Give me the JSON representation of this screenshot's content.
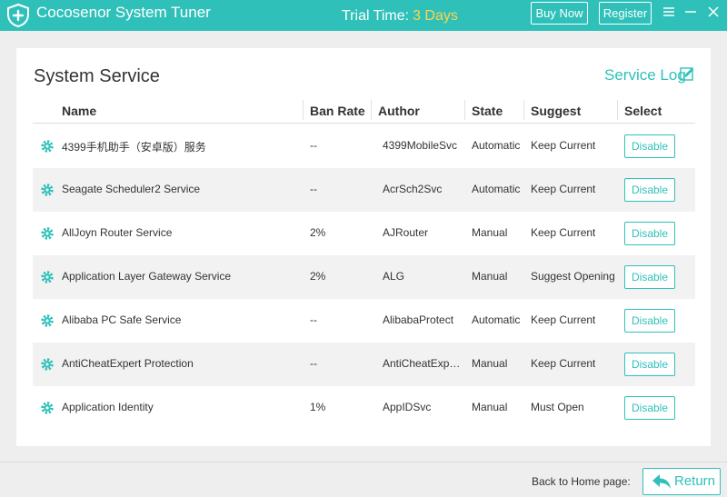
{
  "app": {
    "title": "Cocosenor System Tuner",
    "trial_label": "Trial Time:",
    "trial_days": "3 Days",
    "buy_label": "Buy Now",
    "register_label": "Register",
    "icons": {
      "logo": "shield-plus-icon",
      "menu": "menu-icon",
      "minimize": "minimize-icon",
      "close": "close-icon"
    }
  },
  "colors": {
    "accent": "#2fc1b9",
    "trial_days": "#ffd54a",
    "row_alt": "#f2f2f2"
  },
  "panel": {
    "title": "System Service",
    "service_log_label": "Service Log",
    "columns": [
      "Name",
      "Ban Rate",
      "Author",
      "State",
      "Suggest",
      "Select"
    ],
    "rows": [
      {
        "name": "4399手机助手（安卓版）服务",
        "ban_rate": "--",
        "author": "4399MobileSvc",
        "state": "Automatic",
        "suggest": "Keep Current",
        "action": "Disable"
      },
      {
        "name": "Seagate Scheduler2 Service",
        "ban_rate": "--",
        "author": "AcrSch2Svc",
        "state": "Automatic",
        "suggest": "Keep Current",
        "action": "Disable"
      },
      {
        "name": "AllJoyn Router Service",
        "ban_rate": "2%",
        "author": "AJRouter",
        "state": "Manual",
        "suggest": "Keep Current",
        "action": "Disable"
      },
      {
        "name": "Application Layer Gateway Service",
        "ban_rate": "2%",
        "author": "ALG",
        "state": "Manual",
        "suggest": "Suggest Opening",
        "action": "Disable"
      },
      {
        "name": "Alibaba PC Safe Service",
        "ban_rate": "--",
        "author": "AlibabaProtect",
        "state": "Automatic",
        "suggest": "Keep Current",
        "action": "Disable"
      },
      {
        "name": "AntiCheatExpert Protection",
        "ban_rate": "--",
        "author": "AntiCheatExper...",
        "state": "Manual",
        "suggest": "Keep Current",
        "action": "Disable"
      },
      {
        "name": "Application Identity",
        "ban_rate": "1%",
        "author": "AppIDSvc",
        "state": "Manual",
        "suggest": "Must Open",
        "action": "Disable"
      }
    ]
  },
  "footer": {
    "back_label": "Back to Home page:",
    "return_label": "Return"
  }
}
